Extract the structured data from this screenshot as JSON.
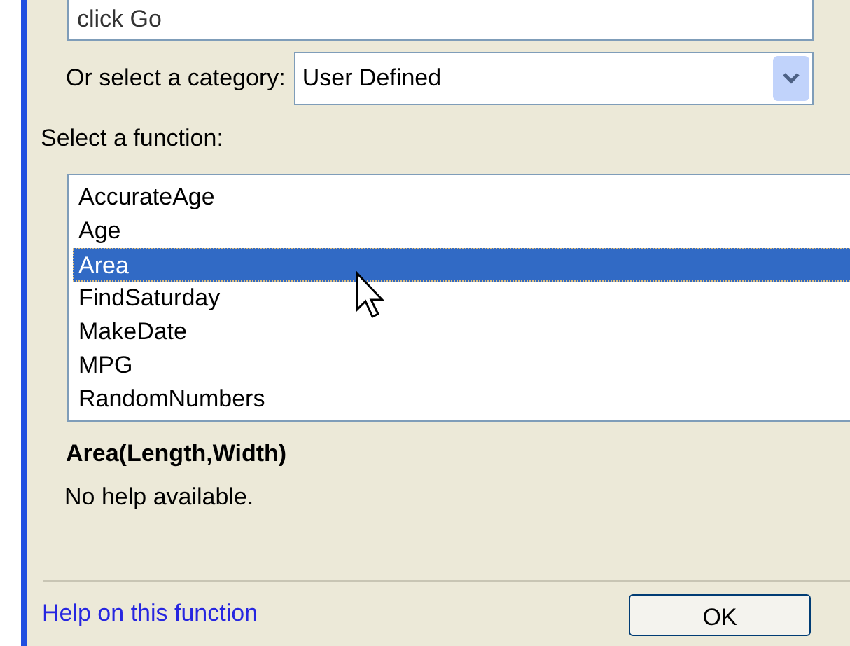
{
  "search_field": {
    "value": "click Go"
  },
  "category": {
    "label": "Or select a category:",
    "value": "User Defined"
  },
  "function_list": {
    "label": "Select a function:",
    "items": [
      {
        "label": "AccurateAge",
        "selected": false
      },
      {
        "label": "Age",
        "selected": false
      },
      {
        "label": "Area",
        "selected": true
      },
      {
        "label": "FindSaturday",
        "selected": false
      },
      {
        "label": "MakeDate",
        "selected": false
      },
      {
        "label": "MPG",
        "selected": false
      },
      {
        "label": "RandomNumbers",
        "selected": false
      }
    ]
  },
  "signature": "Area(Length,Width)",
  "description": "No help available.",
  "help_link": "Help on this function",
  "buttons": [
    "OK"
  ]
}
